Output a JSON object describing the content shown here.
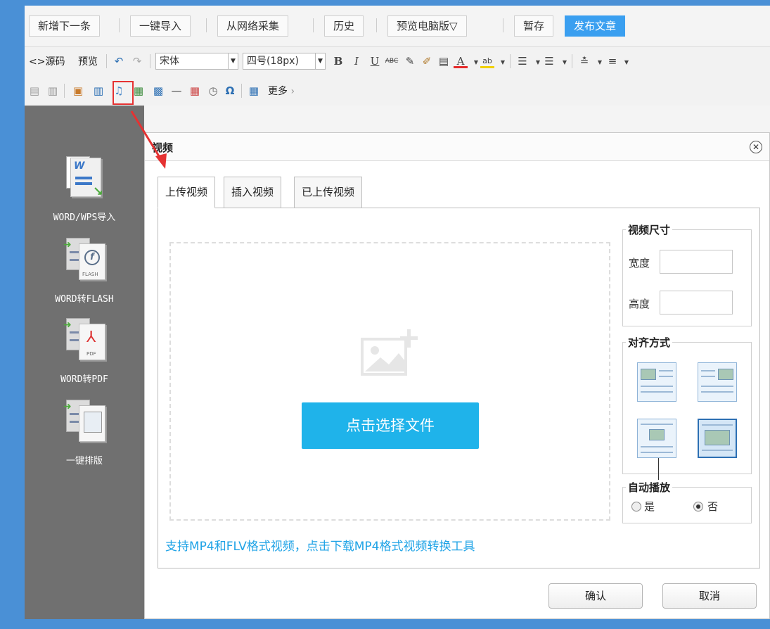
{
  "actionbar": {
    "add_next": "新增下一条",
    "one_click_import": "一键导入",
    "web_collect": "从网络采集",
    "history": "历史",
    "preview_pc": "预览电脑版▽",
    "save_draft": "暂存",
    "publish": "发布文章"
  },
  "toolbar": {
    "source": "<>源码",
    "preview": "预览",
    "font_family": "宋体",
    "font_size": "四号(18px)",
    "bold": "B",
    "italic": "I",
    "underline": "U",
    "strike": "ABC",
    "more": "更多",
    "more_icon": "chevron-right-icon",
    "highlighted_icon": "video-icon"
  },
  "sidebar": {
    "items": [
      {
        "label": "WORD/WPS导入",
        "icon": "word-import-icon"
      },
      {
        "label": "WORD转FLASH",
        "icon": "word-to-flash-icon",
        "badge": "FLASH"
      },
      {
        "label": "WORD转PDF",
        "icon": "word-to-pdf-icon",
        "badge": "PDF"
      },
      {
        "label": "一键排版",
        "icon": "auto-layout-icon"
      }
    ]
  },
  "dialog": {
    "title": "视频",
    "tabs": [
      {
        "label": "上传视频",
        "active": true
      },
      {
        "label": "插入视频",
        "active": false
      },
      {
        "label": "已上传视频",
        "active": false
      }
    ],
    "choose_file": "点击选择文件",
    "support_text": "支持MP4和FLV格式视频，点击下载MP4格式视频转换工具",
    "size_legend": "视频尺寸",
    "width_label": "宽度",
    "height_label": "高度",
    "width_value": "",
    "height_value": "",
    "align_legend": "对齐方式",
    "align_selected": 3,
    "autoplay_legend": "自动播放",
    "autoplay_yes": "是",
    "autoplay_no": "否",
    "autoplay_value": "否",
    "confirm": "确认",
    "cancel": "取消"
  },
  "colors": {
    "accent": "#1fb3ea",
    "publish": "#3a9ff0",
    "frame": "#4a90d6",
    "highlight": "#e53232"
  }
}
